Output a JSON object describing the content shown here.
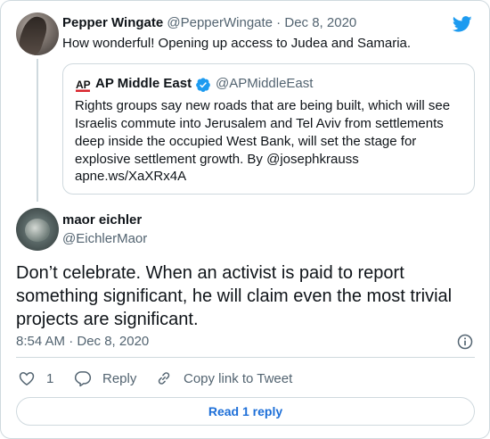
{
  "brand": {
    "twitter_blue": "#1d9bf0",
    "text_primary": "#0f1419",
    "text_secondary": "#536471",
    "border": "#cfd9de",
    "link_blue": "#1d6fd8"
  },
  "parent_tweet": {
    "name": "Pepper Wingate",
    "handle": "@PepperWingate",
    "separator": " · ",
    "date": "Dec 8, 2020",
    "text": "How wonderful! Opening up access to Judea and Samaria."
  },
  "quoted_tweet": {
    "logo_text": "AP",
    "name": "AP Middle East",
    "handle": "@APMiddleEast",
    "text": "Rights groups say new roads that are being built, which will see Israelis commute into Jerusalem and Tel Aviv from settlements deep inside the occupied West Bank, will set the stage for explosive settlement growth. By @josephkrauss",
    "link": "apne.ws/XaXRx4A"
  },
  "main_tweet": {
    "name": "maor eichler",
    "handle": "@EichlerMaor",
    "text": "Don’t celebrate. When an activist is paid to report something significant, he will claim even the most trivial projects are significant.",
    "time": "8:54 AM · Dec 8, 2020"
  },
  "actions": {
    "like_count": "1",
    "reply_label": "Reply",
    "copy_label": "Copy link to Tweet"
  },
  "read_replies_label": "Read 1 reply",
  "icons": [
    "twitter-bird-icon",
    "ap-logo-icon",
    "verified-badge-icon",
    "info-icon",
    "heart-icon",
    "reply-icon",
    "link-icon"
  ]
}
